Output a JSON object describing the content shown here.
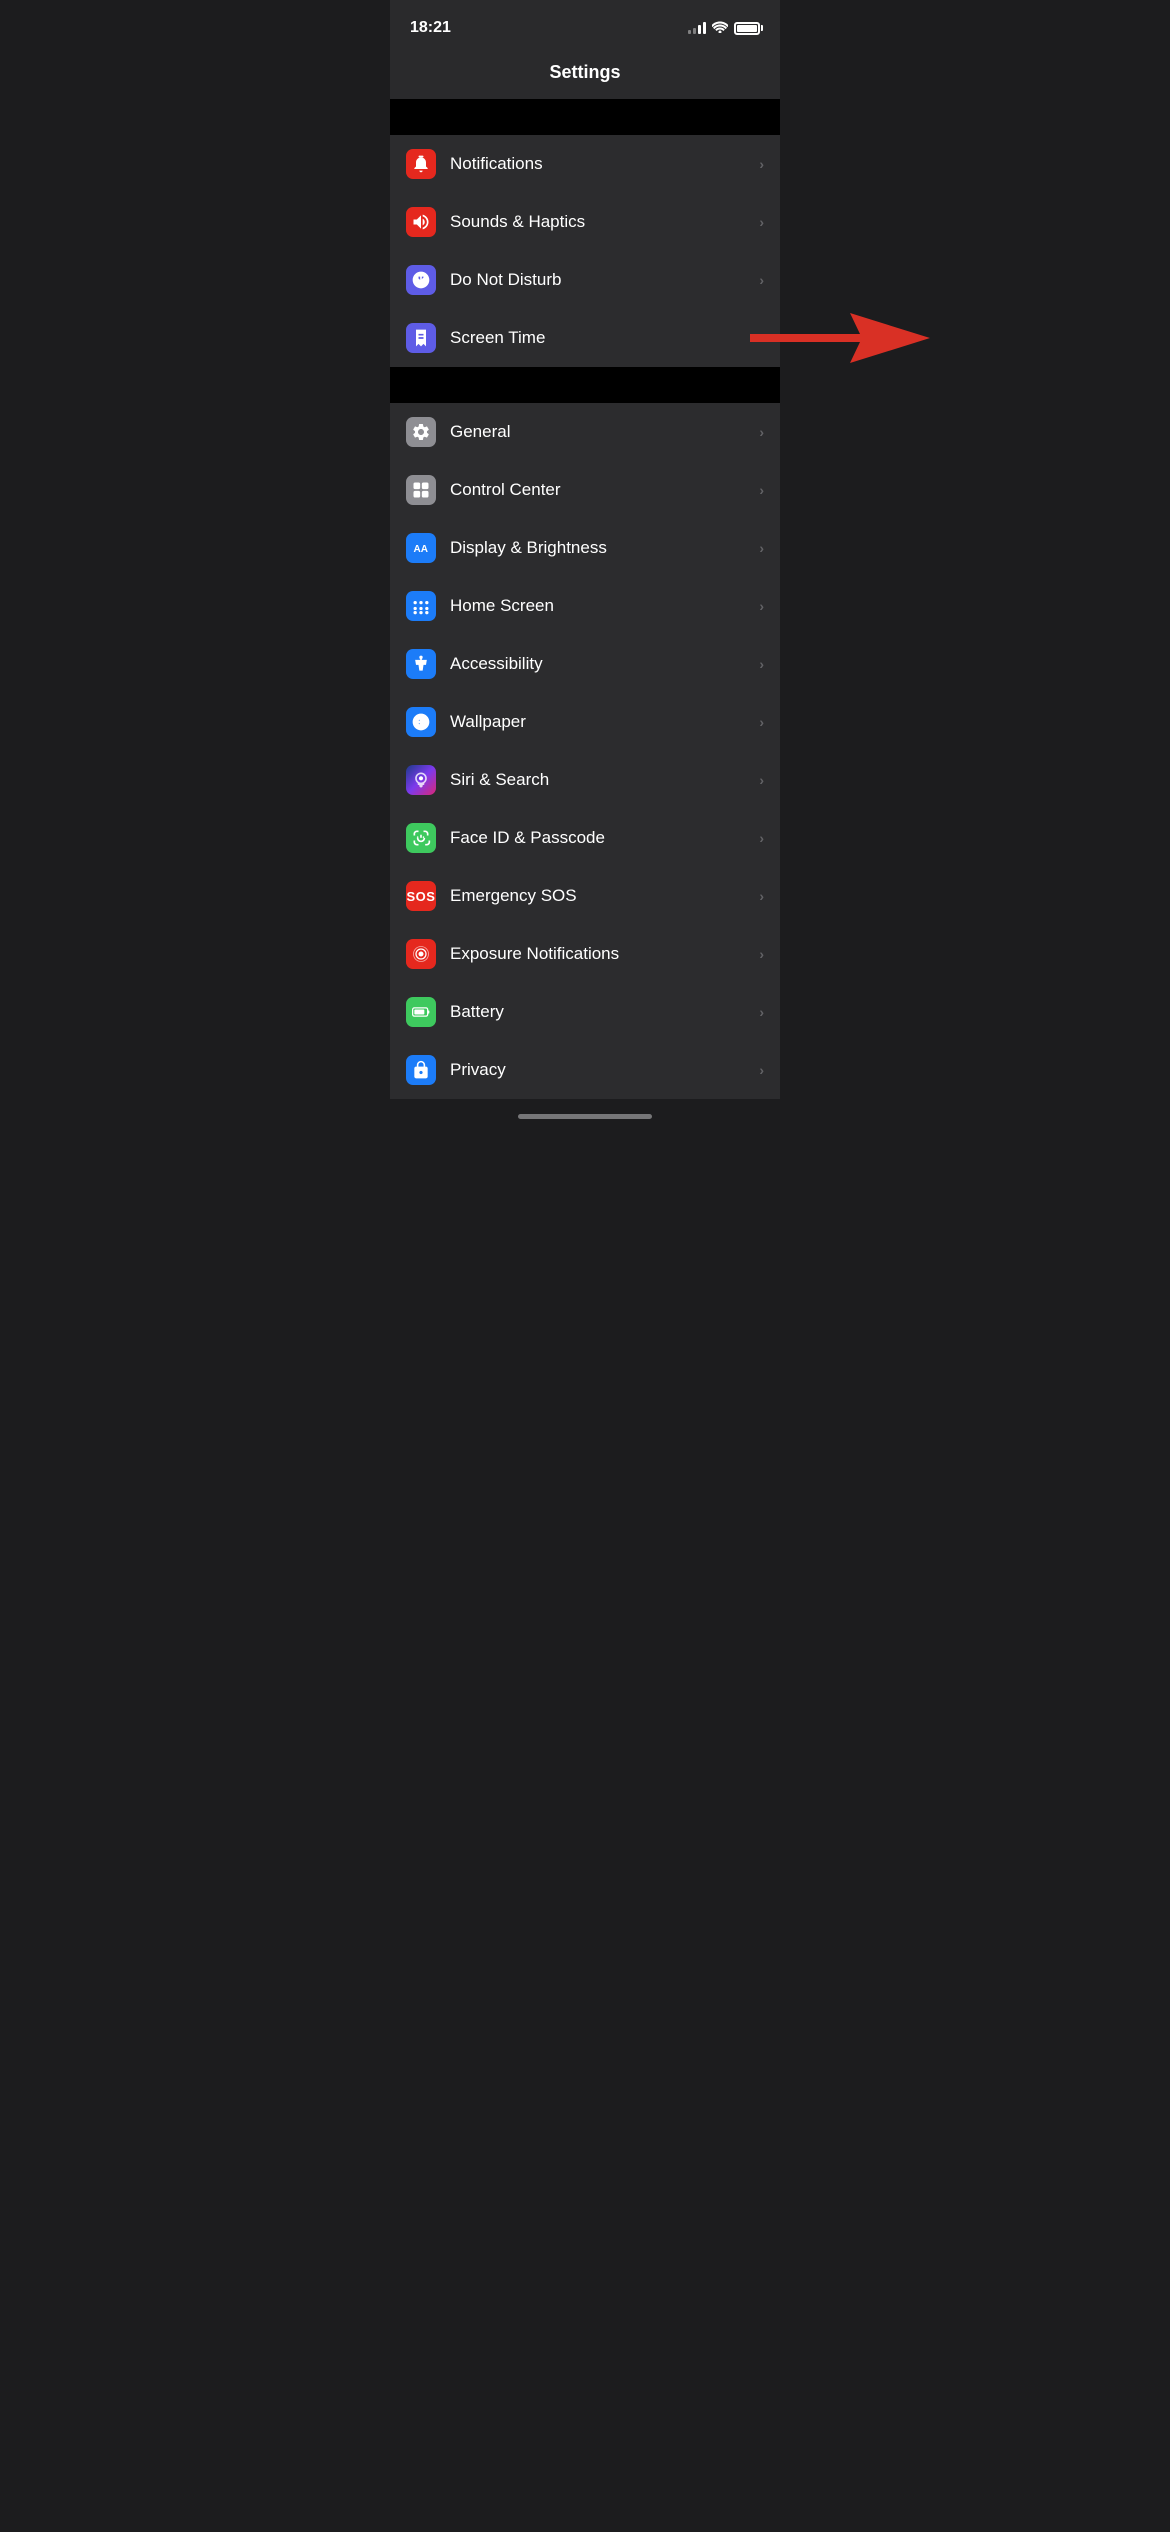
{
  "statusBar": {
    "time": "18:21"
  },
  "header": {
    "title": "Settings"
  },
  "sections": [
    {
      "id": "section1",
      "items": [
        {
          "id": "notifications",
          "label": "Notifications",
          "iconClass": "icon-notifications",
          "iconType": "bell",
          "highlighted": false
        },
        {
          "id": "sounds",
          "label": "Sounds & Haptics",
          "iconClass": "icon-sounds",
          "iconType": "speaker",
          "highlighted": false
        },
        {
          "id": "donotdisturb",
          "label": "Do Not Disturb",
          "iconClass": "icon-donotdisturb",
          "iconType": "moon",
          "highlighted": false
        },
        {
          "id": "screentime",
          "label": "Screen Time",
          "iconClass": "icon-screentime",
          "iconType": "hourglass",
          "highlighted": true,
          "hasArrow": true
        }
      ]
    },
    {
      "id": "section2",
      "items": [
        {
          "id": "general",
          "label": "General",
          "iconClass": "icon-general",
          "iconType": "gear",
          "highlighted": false
        },
        {
          "id": "controlcenter",
          "label": "Control Center",
          "iconClass": "icon-controlcenter",
          "iconType": "toggles",
          "highlighted": false
        },
        {
          "id": "display",
          "label": "Display & Brightness",
          "iconClass": "icon-display",
          "iconType": "aa",
          "highlighted": false
        },
        {
          "id": "homescreen",
          "label": "Home Screen",
          "iconClass": "icon-homescreen",
          "iconType": "grid",
          "highlighted": false
        },
        {
          "id": "accessibility",
          "label": "Accessibility",
          "iconClass": "icon-accessibility",
          "iconType": "person",
          "highlighted": false
        },
        {
          "id": "wallpaper",
          "label": "Wallpaper",
          "iconClass": "icon-wallpaper",
          "iconType": "flower",
          "highlighted": false
        },
        {
          "id": "siri",
          "label": "Siri & Search",
          "iconClass": "icon-siri",
          "iconType": "siri",
          "highlighted": false
        },
        {
          "id": "faceid",
          "label": "Face ID & Passcode",
          "iconClass": "icon-faceid",
          "iconType": "face",
          "highlighted": false
        },
        {
          "id": "emergency",
          "label": "Emergency SOS",
          "iconClass": "icon-emergency",
          "iconType": "sos",
          "highlighted": false
        },
        {
          "id": "exposure",
          "label": "Exposure Notifications",
          "iconClass": "icon-exposure",
          "iconType": "exposure",
          "highlighted": false
        },
        {
          "id": "battery",
          "label": "Battery",
          "iconClass": "icon-battery",
          "iconType": "battery",
          "highlighted": false
        },
        {
          "id": "privacy",
          "label": "Privacy",
          "iconClass": "icon-privacy",
          "iconType": "privacy",
          "highlighted": false
        }
      ]
    }
  ]
}
